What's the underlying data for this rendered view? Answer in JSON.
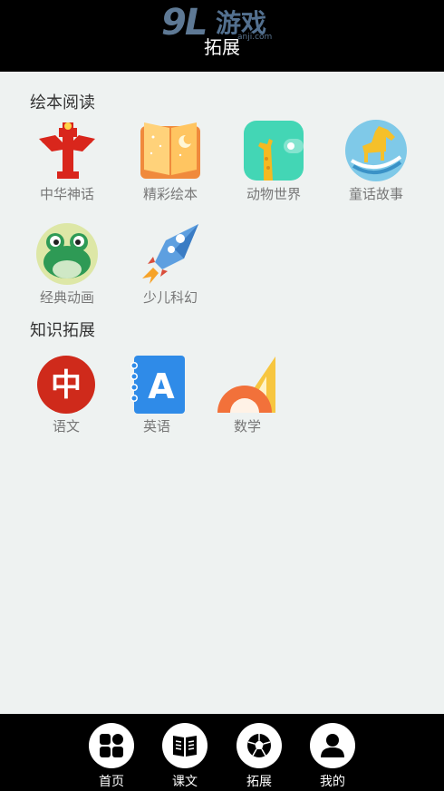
{
  "watermark": {
    "logo": "9L",
    "text": "游戏",
    "url": "anji.com"
  },
  "header": {
    "title": "拓展"
  },
  "sections": [
    {
      "title": "绘本阅读"
    },
    {
      "title": "知识拓展"
    }
  ],
  "picture_books": [
    {
      "label": "中华神话",
      "icon": "totem-icon"
    },
    {
      "label": "精彩绘本",
      "icon": "open-book-icon"
    },
    {
      "label": "动物世界",
      "icon": "giraffe-icon"
    },
    {
      "label": "童话故事",
      "icon": "rocking-horse-icon"
    },
    {
      "label": "经典动画",
      "icon": "frog-icon"
    },
    {
      "label": "少儿科幻",
      "icon": "rocket-icon"
    }
  ],
  "knowledge": [
    {
      "label": "语文",
      "icon": "chinese-char-icon",
      "glyph": "中"
    },
    {
      "label": "英语",
      "icon": "letter-a-notebook-icon",
      "glyph": "A"
    },
    {
      "label": "数学",
      "icon": "protractor-icon"
    }
  ],
  "tabs": [
    {
      "label": "首页",
      "icon": "grid-icon"
    },
    {
      "label": "课文",
      "icon": "book-icon"
    },
    {
      "label": "拓展",
      "icon": "ball-icon"
    },
    {
      "label": "我的",
      "icon": "user-icon"
    }
  ],
  "colors": {
    "header_bg": "#000000",
    "page_bg": "#eef2f1",
    "label": "#777777"
  }
}
